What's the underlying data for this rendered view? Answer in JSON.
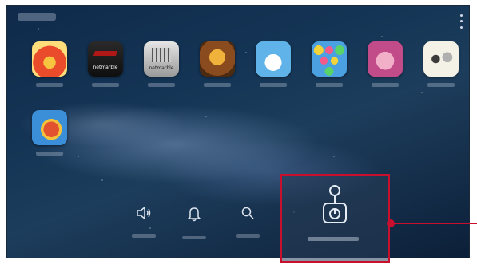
{
  "home_screen": {
    "apps": [
      {
        "name": "app-angry-bird-icon",
        "colors": [
          "#e94b2b",
          "#f6c43f"
        ]
      },
      {
        "name": "app-netmarble-dark-icon",
        "colors": [
          "#1a1a1a",
          "#b01818"
        ],
        "text": "netmarble"
      },
      {
        "name": "app-netmarble-light-icon",
        "colors": [
          "#d9d9d9",
          "#6a6a6a"
        ],
        "text": "netmarble"
      },
      {
        "name": "app-warrior-game-icon",
        "colors": [
          "#8a4b1e",
          "#f0b23a"
        ]
      },
      {
        "name": "app-monster-game-icon",
        "colors": [
          "#5fb3e8",
          "#ffffff"
        ]
      },
      {
        "name": "app-bubble-shooter-icon",
        "colors": [
          "#4aa0e0",
          "#f25a8a"
        ]
      },
      {
        "name": "app-pink-character-icon",
        "colors": [
          "#c24b8a",
          "#f2b0c8"
        ]
      },
      {
        "name": "app-cartoon-characters-icon",
        "colors": [
          "#f4f1e6",
          "#3b3b3b"
        ]
      },
      {
        "name": "app-parrot-icon",
        "colors": [
          "#3a8fd8",
          "#e2522e"
        ]
      }
    ],
    "quick_actions": [
      {
        "name": "sound-icon"
      },
      {
        "name": "notification-bell-icon"
      },
      {
        "name": "search-icon"
      }
    ],
    "game_launcher": {
      "icon": "game-launcher-joystick-icon",
      "highlight_color": "#c8102e"
    }
  }
}
